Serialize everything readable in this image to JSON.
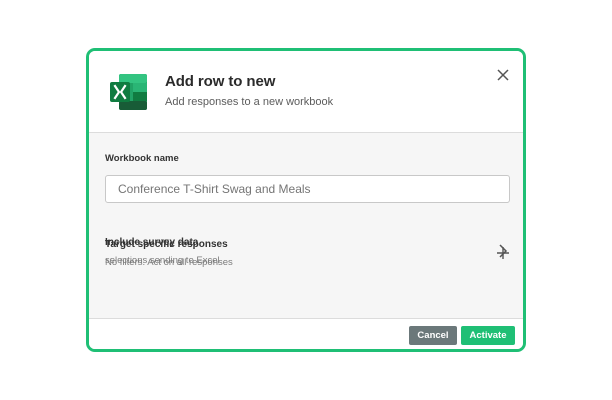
{
  "modal": {
    "title": "Add row to new",
    "subtitle": "Add responses to a new workbook",
    "icon": "excel-icon",
    "close_icon": "close-icon"
  },
  "workbook": {
    "label": "Workbook name",
    "placeholder": "Conference T-Shirt Swag and Meals"
  },
  "options": [
    {
      "title": "Include survey data",
      "subtitle": "selections sending to Excel",
      "icon": "chevron-right-icon"
    },
    {
      "title": "Target specific responses",
      "subtitle": "No filters. Act on all responses",
      "icon": "plus-icon"
    }
  ],
  "footer": {
    "cancel_label": "Cancel",
    "activate_label": "Activate"
  },
  "colors": {
    "accent": "#1fbf75",
    "cancel": "#6b787a",
    "excel_dark": "#185c37",
    "excel_mid": "#21a366",
    "excel_light": "#33c481"
  }
}
